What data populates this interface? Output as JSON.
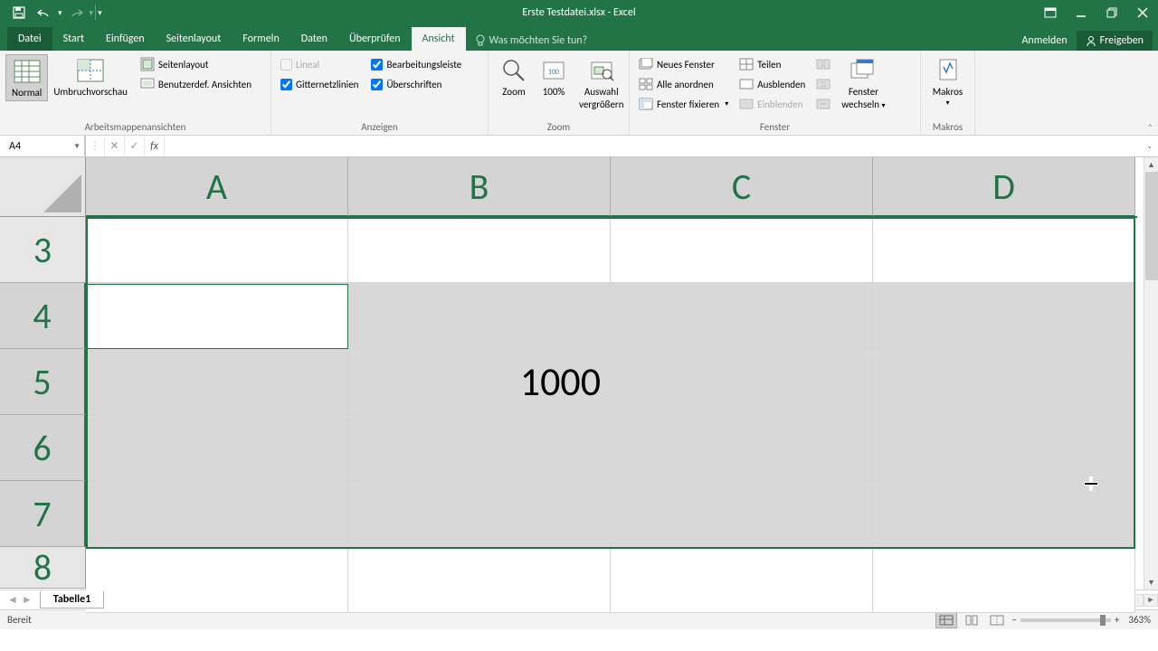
{
  "titlebar": {
    "title": "Erste Testdatei.xlsx - Excel"
  },
  "tabs": {
    "file": "Datei",
    "home": "Start",
    "insert": "Einfügen",
    "pagelayout": "Seitenlayout",
    "formulas": "Formeln",
    "data": "Daten",
    "review": "Überprüfen",
    "view": "Ansicht",
    "tellme": "Was möchten Sie tun?",
    "signin": "Anmelden",
    "share": "Freigeben"
  },
  "ribbon": {
    "views_group": "Arbeitsmappenansichten",
    "normal": "Normal",
    "pagebreak": "Umbruchvorschau",
    "pagelayout_btn": "Seitenlayout",
    "custom_views": "Benutzerdef. Ansichten",
    "show_group": "Anzeigen",
    "ruler": "Lineal",
    "gridlines": "Gitternetzlinien",
    "formula_bar_chk": "Bearbeitungsleiste",
    "headings": "Überschriften",
    "zoom_group": "Zoom",
    "zoom": "Zoom",
    "zoom100": "100%",
    "zoom_selection_1": "Auswahl",
    "zoom_selection_2": "vergrößern",
    "window_group": "Fenster",
    "new_window": "Neues Fenster",
    "arrange_all": "Alle anordnen",
    "freeze_panes": "Fenster fixieren",
    "split": "Teilen",
    "hide": "Ausblenden",
    "unhide": "Einblenden",
    "switch_1": "Fenster",
    "switch_2": "wechseln",
    "macros_group": "Makros",
    "macros": "Makros"
  },
  "formulabar": {
    "namebox": "A4",
    "formula": ""
  },
  "grid": {
    "columns": [
      "A",
      "B",
      "C",
      "D"
    ],
    "rows": [
      "3",
      "4",
      "5",
      "6",
      "7",
      "8"
    ],
    "cells": {
      "B5": "1000"
    }
  },
  "sheets": {
    "sheet1": "Tabelle1"
  },
  "statusbar": {
    "ready": "Bereit",
    "zoom": "363%"
  }
}
